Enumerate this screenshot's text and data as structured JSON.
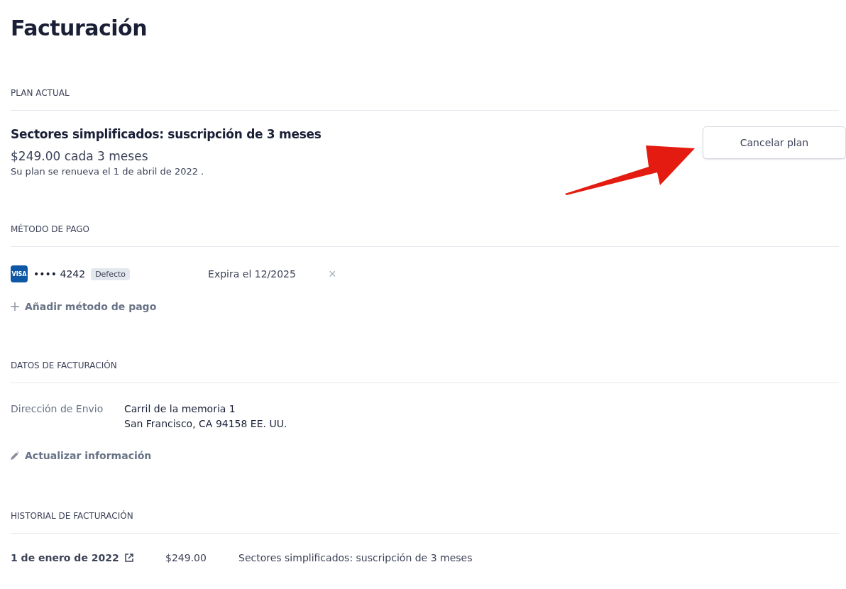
{
  "title": "Facturación",
  "current_plan": {
    "heading": "PLAN ACTUAL",
    "name": "Sectores simplificados: suscripción de 3 meses",
    "price": "$249.00 cada 3 meses",
    "renewal": "Su plan se renueva el 1 de abril de 2022 .",
    "cancel_button": "Cancelar plan"
  },
  "payment_method": {
    "heading": "MÉTODO DE PAGO",
    "cards": [
      {
        "brand": "VISA",
        "number": "•••• 4242",
        "badge": "Defecto",
        "expiry": "Expira el 12/2025",
        "remove": "×"
      }
    ],
    "add_link": "Añadir método de pago"
  },
  "billing_details": {
    "heading": "DATOS DE FACTURACIÓN",
    "label": "Dirección de Envio",
    "address": [
      "Carril de la memoria 1",
      "San Francisco, CA 94158 EE. UU."
    ],
    "update_link": "Actualizar información"
  },
  "billing_history": {
    "heading": "HISTORIAL DE FACTURACIÓN",
    "rows": [
      {
        "date": "1 de enero de 2022",
        "amount": "$249.00",
        "description": "Sectores simplificados: suscripción de 3 meses"
      }
    ]
  }
}
